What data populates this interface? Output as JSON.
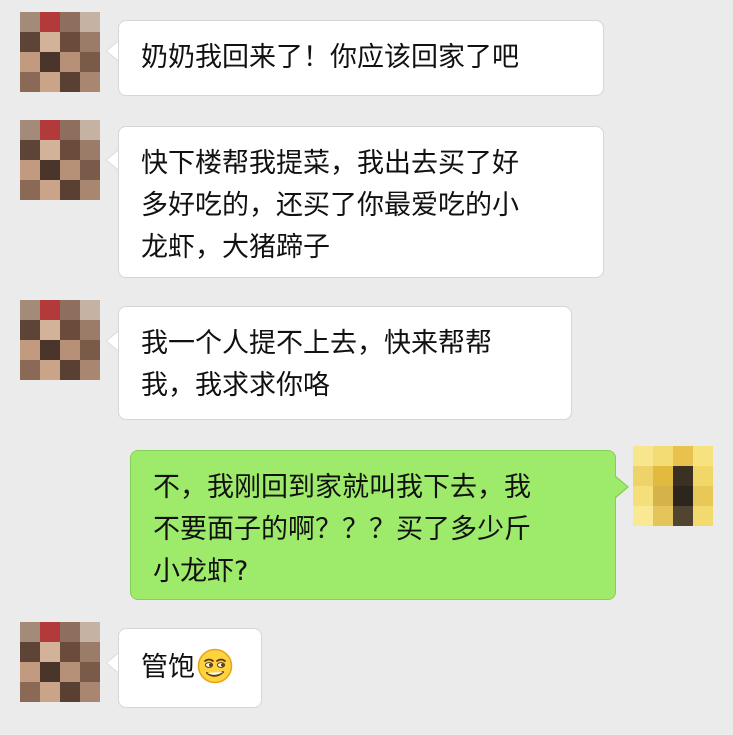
{
  "messages": [
    {
      "sender": "other",
      "lines": [
        "奶奶我回来了！你应该回家了吧"
      ]
    },
    {
      "sender": "other",
      "lines": [
        "快下楼帮我提菜，我出去买了好",
        "多好吃的，还买了你最爱吃的小",
        "龙虾，大猪蹄子"
      ]
    },
    {
      "sender": "other",
      "lines": [
        "我一个人提不上去，快来帮帮",
        "我，我求求你咯"
      ]
    },
    {
      "sender": "me",
      "lines": [
        "不，我刚回到家就叫我下去，我",
        "不要面子的啊？？？买了多少斤",
        "小龙虾?"
      ]
    },
    {
      "sender": "other",
      "lines": [
        "管饱"
      ],
      "emoji": "smirk-face-emoji"
    }
  ],
  "colors": {
    "background": "#ebebeb",
    "incoming_bubble": "#ffffff",
    "outgoing_bubble": "#9eea6a"
  }
}
